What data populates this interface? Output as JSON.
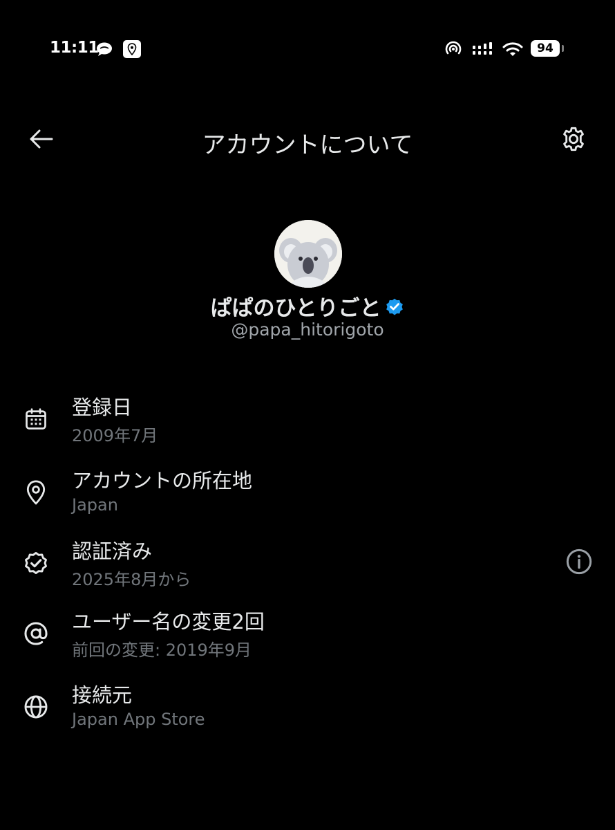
{
  "status_bar": {
    "time": "11:11",
    "battery": "94",
    "icons": [
      "message-icon",
      "location-icon",
      "airdrop-icon",
      "cellular-signal-icon",
      "wifi-icon",
      "battery-icon"
    ]
  },
  "header": {
    "title": "アカウントについて",
    "back_icon": "arrow-left-icon",
    "settings_icon": "gear-icon"
  },
  "profile": {
    "display_name": "ぱぱのひとりごと",
    "handle": "@papa_hitorigoto",
    "verified": true,
    "verified_color": "#1d9bf0",
    "avatar_icon": "koala-avatar"
  },
  "details": [
    {
      "icon": "calendar-icon",
      "title": "登録日",
      "subtitle": "2009年7月"
    },
    {
      "icon": "location-pin-icon",
      "title": "アカウントの所在地",
      "subtitle": "Japan"
    },
    {
      "icon": "verified-badge-icon",
      "title": "認証済み",
      "subtitle": "2025年8月から",
      "action_icon": "info-icon"
    },
    {
      "icon": "at-sign-icon",
      "title": "ユーザー名の変更2回",
      "subtitle": "前回の変更: 2019年9月"
    },
    {
      "icon": "globe-icon",
      "title": "接続元",
      "subtitle": "Japan App Store"
    }
  ],
  "colors": {
    "background": "#000000",
    "primary_text": "#e7e9ea",
    "secondary_text": "#71767b",
    "accent": "#1d9bf0"
  }
}
